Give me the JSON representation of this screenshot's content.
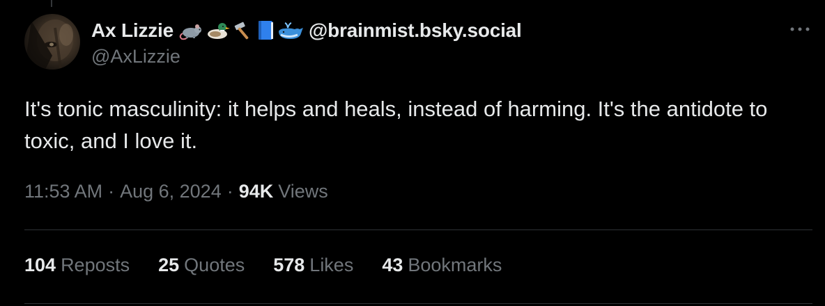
{
  "author": {
    "display_name": "Ax Lizzie",
    "name_suffix": "@brainmist.bsky.social",
    "handle": "@AxLizzie",
    "emojis": [
      "rat-emoji",
      "duck-emoji",
      "hammer-emoji",
      "blue-book-emoji",
      "whale-emoji"
    ]
  },
  "tweet": {
    "text": "It's tonic masculinity: it helps and heals, instead of harming. It's the antidote to toxic, and I love it."
  },
  "meta": {
    "time": "11:53 AM",
    "separator": "·",
    "date": "Aug 6, 2024",
    "views_count": "94K",
    "views_label": "Views"
  },
  "stats": [
    {
      "count": "104",
      "label": "Reposts"
    },
    {
      "count": "25",
      "label": "Quotes"
    },
    {
      "count": "578",
      "label": "Likes"
    },
    {
      "count": "43",
      "label": "Bookmarks"
    }
  ],
  "colors": {
    "background": "#000000",
    "primary_text": "#e7e9ea",
    "secondary_text": "#71767b",
    "divider": "#2f3336"
  }
}
